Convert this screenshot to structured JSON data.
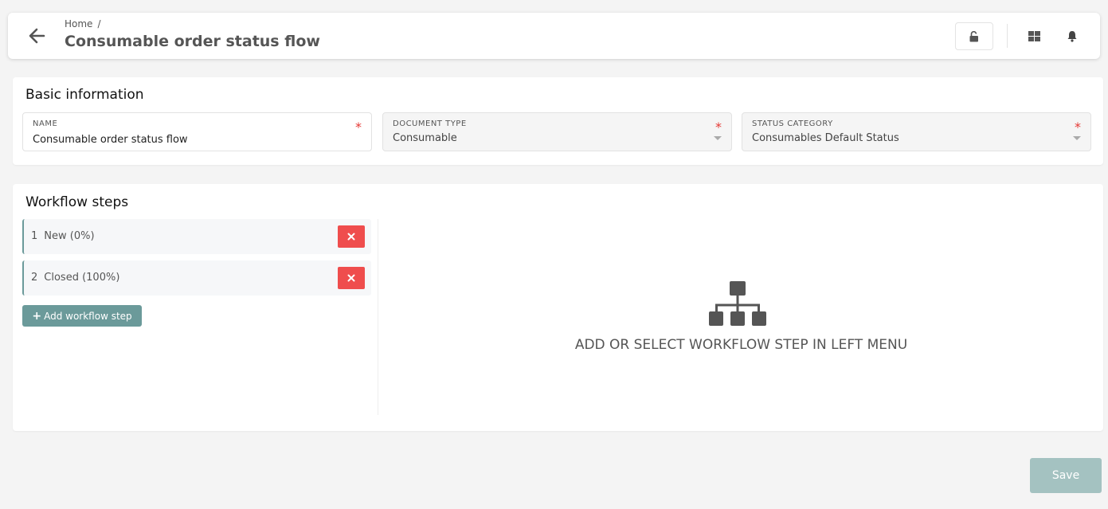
{
  "header": {
    "breadcrumb_home": "Home",
    "breadcrumb_separator": "/",
    "title": "Consumable order status flow",
    "icons": {
      "back": "arrow-left-icon",
      "lock": "unlock-icon",
      "apps": "grid-icon",
      "notifications": "bell-icon"
    }
  },
  "basic_info": {
    "title": "Basic information",
    "fields": [
      {
        "label": "NAME",
        "value": "Consumable order status flow",
        "required_mark": "*"
      },
      {
        "label": "DOCUMENT TYPE",
        "value": "Consumable",
        "required_mark": "*"
      },
      {
        "label": "STATUS CATEGORY",
        "value": "Consumables Default Status",
        "required_mark": "*"
      }
    ]
  },
  "workflow": {
    "title": "Workflow steps",
    "steps": [
      {
        "number": "1",
        "label": "New (0%)"
      },
      {
        "number": "2",
        "label": "Closed (100%)"
      }
    ],
    "add_button_label": "Add workflow step",
    "empty_state_text": "ADD OR SELECT WORKFLOW STEP IN LEFT MENU",
    "empty_state_icon": "sitemap-icon"
  },
  "footer": {
    "save_label": "Save"
  },
  "colors": {
    "accent": "#6b9a9a",
    "danger": "#ef4d4d",
    "save_disabled": "#a4c2c1",
    "required": "#e53935"
  }
}
